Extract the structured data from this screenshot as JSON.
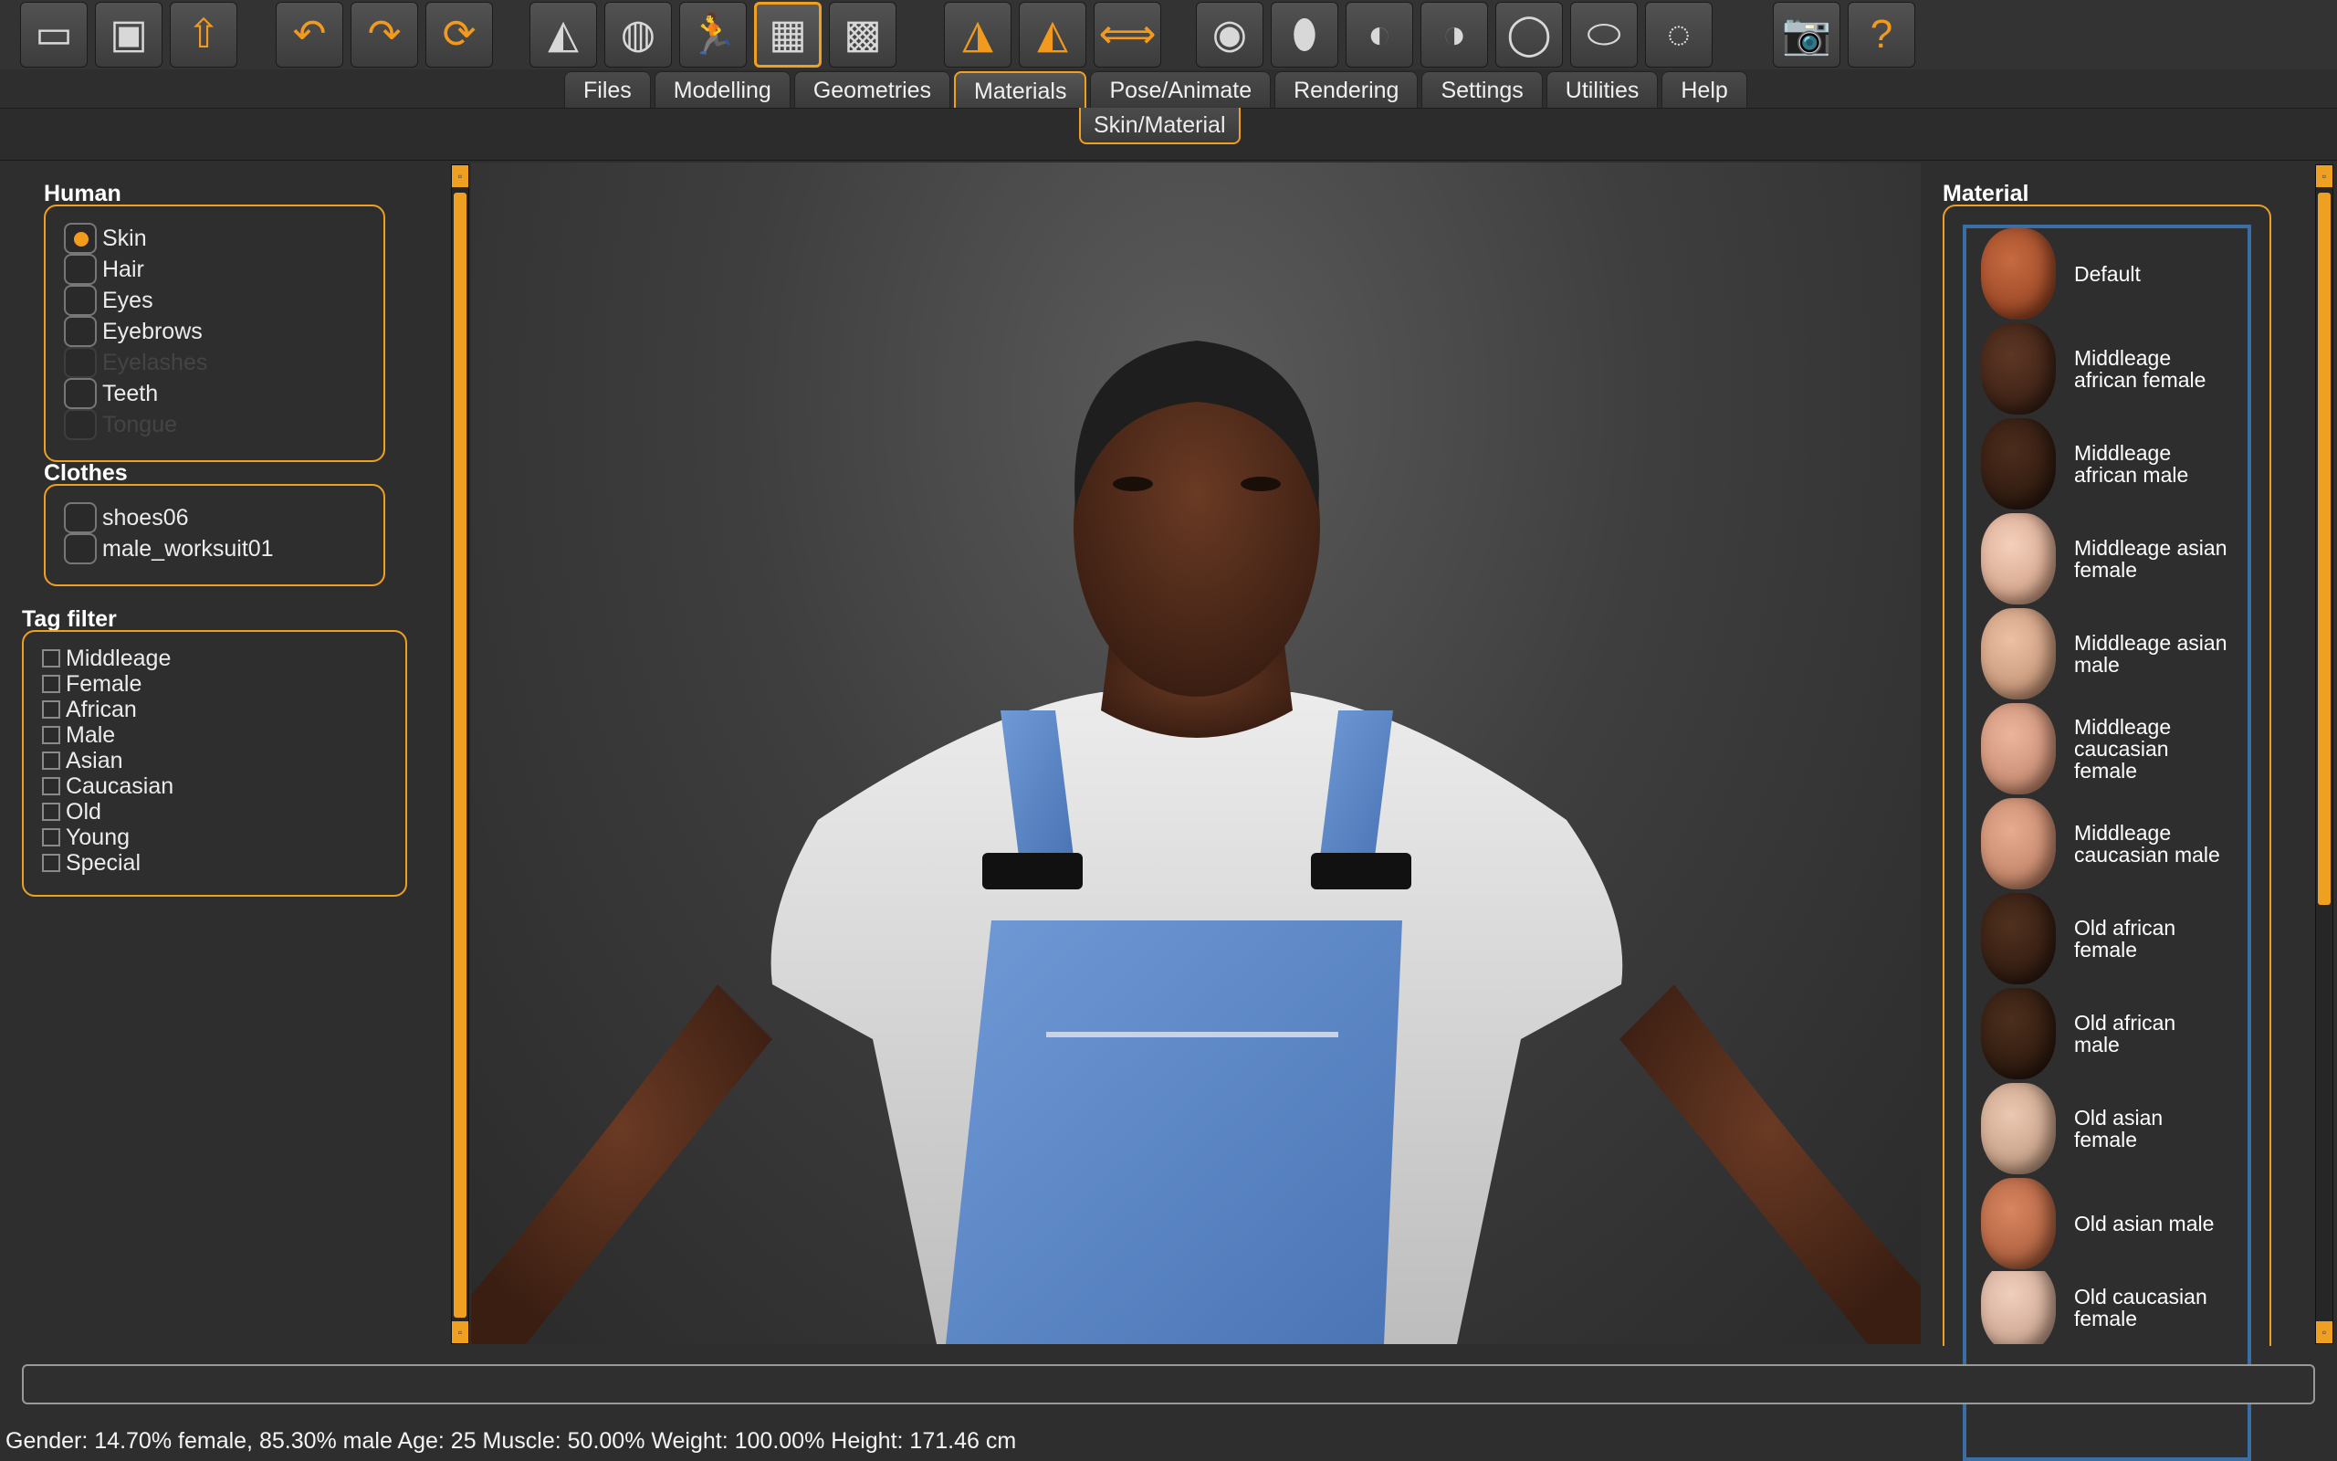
{
  "toolbar": {
    "icons": [
      "folder-icon",
      "save-icon",
      "export-icon",
      "undo-icon",
      "redo-icon",
      "reset-icon",
      "smooth-icon",
      "wireframe-icon",
      "pose-icon",
      "grid-icon",
      "checker-icon",
      "front-view-icon",
      "back-view-icon",
      "side-view-icon",
      "face-front-icon",
      "face-back-icon",
      "face-left-icon",
      "face-right-icon",
      "top-view-icon",
      "bottom-view-icon",
      "symmetry-icon",
      "camera-icon",
      "help-icon"
    ]
  },
  "tabs": [
    "Files",
    "Modelling",
    "Geometries",
    "Materials",
    "Pose/Animate",
    "Rendering",
    "Settings",
    "Utilities",
    "Help"
  ],
  "active_tab": "Materials",
  "subtab": "Skin/Material",
  "human": {
    "title": "Human",
    "items": [
      {
        "label": "Skin",
        "selected": true,
        "enabled": true
      },
      {
        "label": "Hair",
        "selected": false,
        "enabled": true
      },
      {
        "label": "Eyes",
        "selected": false,
        "enabled": true
      },
      {
        "label": "Eyebrows",
        "selected": false,
        "enabled": true
      },
      {
        "label": "Eyelashes",
        "selected": false,
        "enabled": false
      },
      {
        "label": "Teeth",
        "selected": false,
        "enabled": true
      },
      {
        "label": "Tongue",
        "selected": false,
        "enabled": false
      }
    ]
  },
  "clothes": {
    "title": "Clothes",
    "items": [
      "shoes06",
      "male_worksuit01"
    ]
  },
  "tag_filter": {
    "title": "Tag filter",
    "items": [
      "Middleage",
      "Female",
      "African",
      "Male",
      "Asian",
      "Caucasian",
      "Old",
      "Young",
      "Special"
    ]
  },
  "material": {
    "title": "Material",
    "items": [
      {
        "label": "Default",
        "tone": "#b1552f"
      },
      {
        "label": "Middleage african female",
        "tone": "#4a2a1e"
      },
      {
        "label": "Middleage african male",
        "tone": "#3c2519"
      },
      {
        "label": "Middleage asian female",
        "tone": "#e6b59c"
      },
      {
        "label": "Middleage asian male",
        "tone": "#d9a588"
      },
      {
        "label": "Middleage caucasian female",
        "tone": "#d99a80"
      },
      {
        "label": "Middleage caucasian male",
        "tone": "#d49378"
      },
      {
        "label": "Old african female",
        "tone": "#3e2218"
      },
      {
        "label": "Old african male",
        "tone": "#3a2217"
      },
      {
        "label": "Old asian female",
        "tone": "#d7ad92"
      },
      {
        "label": "Old asian male",
        "tone": "#c7714a"
      },
      {
        "label": "Old caucasian female",
        "tone": "#dfb9a4"
      }
    ]
  },
  "status": "Gender: 14.70% female, 85.30% male Age: 25 Muscle: 50.00% Weight: 100.00% Height: 171.46 cm",
  "command_line": ""
}
